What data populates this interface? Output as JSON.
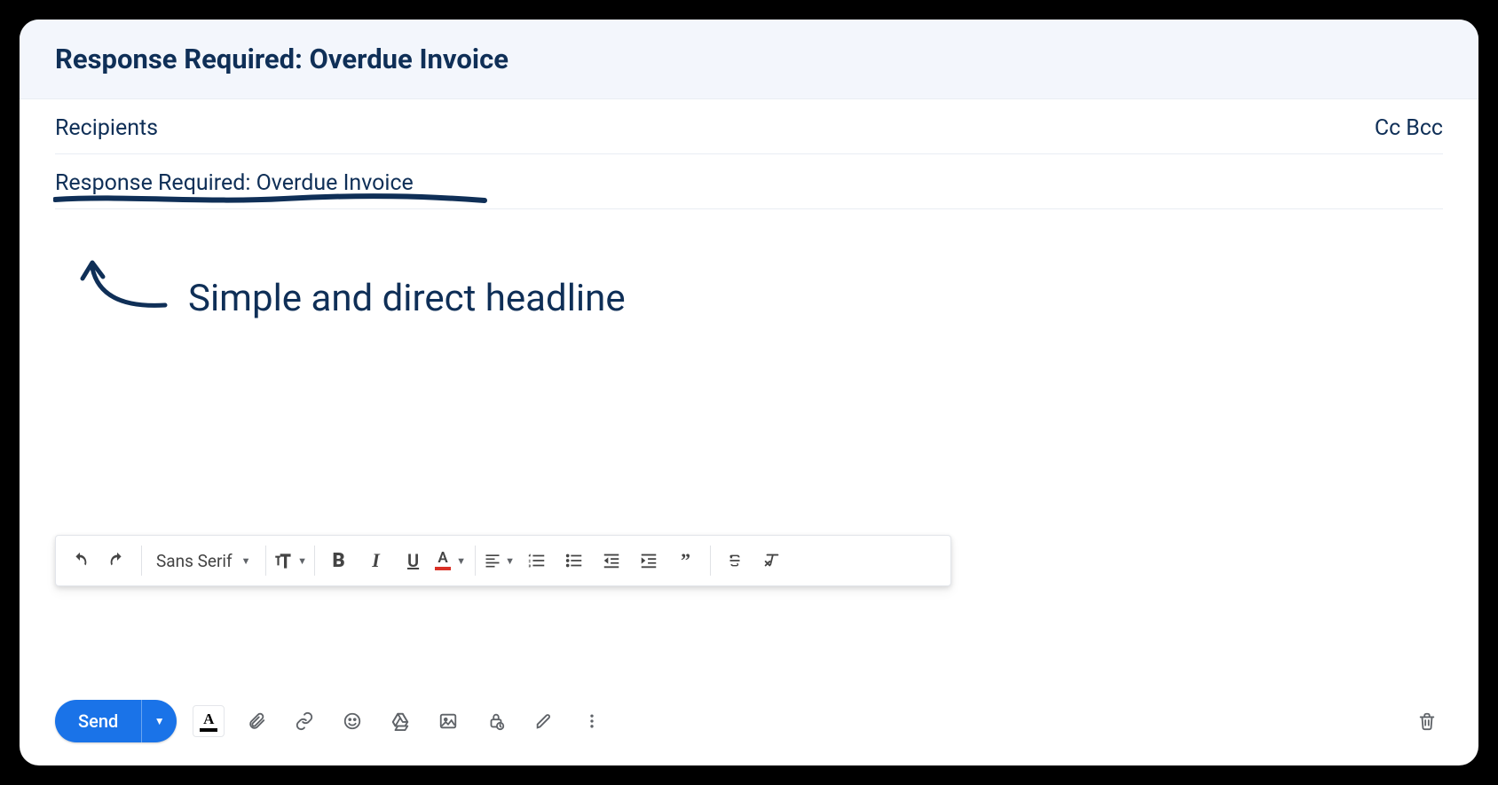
{
  "header": {
    "title": "Response Required: Overdue Invoice"
  },
  "fields": {
    "recipients_label": "Recipients",
    "cc_label": "Cc",
    "bcc_label": "Bcc",
    "subject_value": "Response Required: Overdue Invoice"
  },
  "annotation": {
    "text": "Simple and direct headline"
  },
  "formatting": {
    "font_name": "Sans Serif",
    "icons": {
      "undo": "undo-icon",
      "redo": "redo-icon",
      "textsize": "text-size-icon",
      "bold": "bold-icon",
      "italic": "italic-icon",
      "underline": "underline-icon",
      "textcolor": "text-color-icon",
      "align": "align-icon",
      "numlist": "numbered-list-icon",
      "bullist": "bullet-list-icon",
      "outdent": "indent-less-icon",
      "indent": "indent-more-icon",
      "quote": "quote-icon",
      "strike": "strikethrough-icon",
      "clear": "clear-format-icon"
    }
  },
  "bottom": {
    "send_label": "Send",
    "icons": {
      "fontchip": "formatting-chip-icon",
      "attach": "attachment-icon",
      "link": "link-icon",
      "emoji": "emoji-icon",
      "drive": "drive-icon",
      "image": "image-icon",
      "lock": "confidential-icon",
      "pen": "signature-icon",
      "more": "more-options-icon",
      "trash": "trash-icon"
    }
  }
}
